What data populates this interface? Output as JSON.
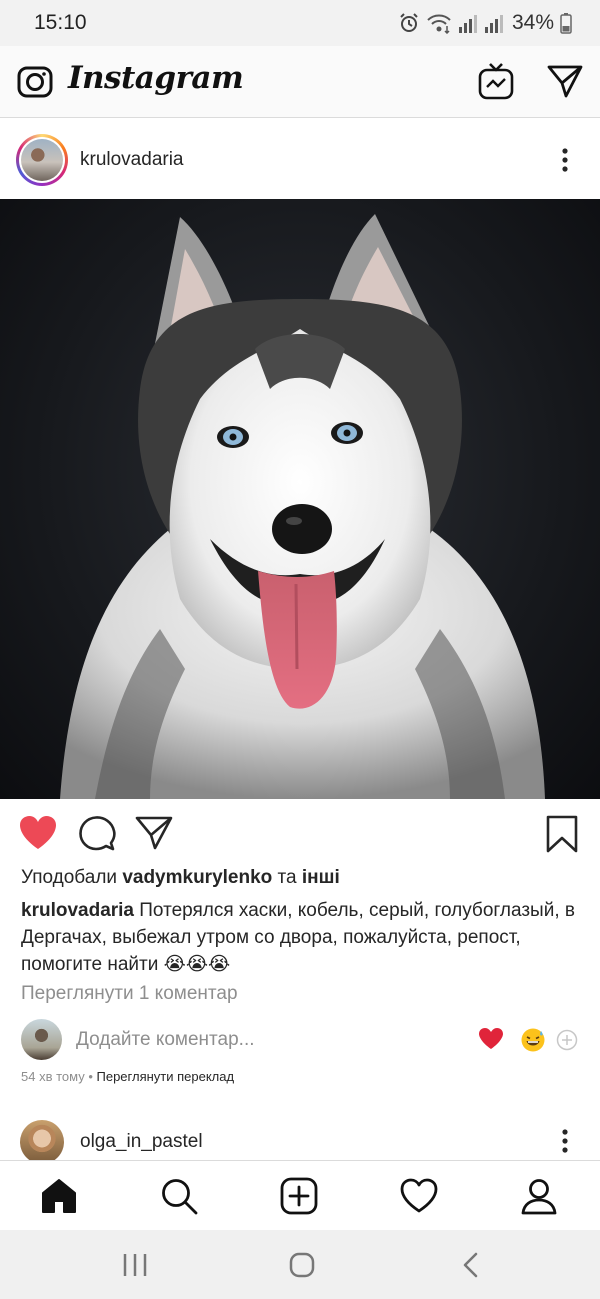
{
  "status_bar": {
    "time": "15:10",
    "battery": "34%",
    "icons": [
      "alarm-icon",
      "wifi-icon",
      "signal-icon",
      "signal-icon",
      "battery-icon"
    ]
  },
  "header": {
    "brand": "Instagram",
    "icons": [
      "camera-icon",
      "igtv-icon",
      "direct-message-icon"
    ]
  },
  "post": {
    "username": "krulovadaria",
    "likes": {
      "prefix": "Уподобали ",
      "user": "vadymkurylenko",
      "middle": " та ",
      "others": "інші"
    },
    "caption": {
      "username": "krulovadaria",
      "text": " Потерялся хаски, кобель, серый, голубоглазый, в Дергачах, выбежал утром со двора, пожалуйста, репост, помогите найти 😭😭😭"
    },
    "view_comments": "Переглянути 1 коментар",
    "comment_placeholder": "Додайте коментар...",
    "time_ago": "54 хв тому",
    "separator": " • ",
    "translate": "Переглянути переклад",
    "liked": true,
    "colors": {
      "like": "#ed4956",
      "text": "#262626",
      "muted": "#8e8e8e"
    }
  },
  "next_post": {
    "username": "olga_in_pastel"
  },
  "bottom_nav": [
    "home-icon",
    "search-icon",
    "add-post-icon",
    "activity-heart-icon",
    "profile-icon"
  ],
  "system_nav": [
    "recents-icon",
    "home-pill-icon",
    "back-icon"
  ]
}
